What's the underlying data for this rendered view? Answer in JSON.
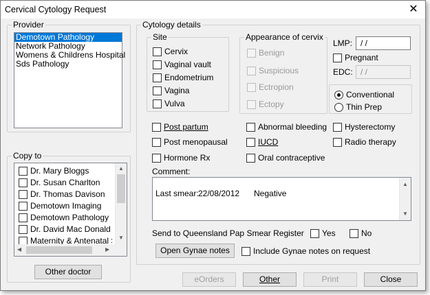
{
  "window": {
    "title": "Cervical Cytology Request",
    "close_glyph": "✕"
  },
  "provider": {
    "group_label": "Provider",
    "items": [
      "Demotown Pathology",
      "Network Pathology",
      "Womens & Childrens Hospital",
      "Sds Pathology"
    ],
    "selected_index": 0
  },
  "copy_to": {
    "group_label": "Copy to",
    "items": [
      "Dr. Mary Bloggs",
      "Dr. Susan Charlton",
      "Dr. Thomas Davison",
      "Demotown Imaging",
      "Demotown Pathology",
      "Dr. David Mac Donald",
      "Maternity & Antenatal Sc"
    ],
    "other_doctor_label": "Other doctor"
  },
  "cytology": {
    "group_label": "Cytology details",
    "site": {
      "label": "Site",
      "items": [
        "Cervix",
        "Vaginal vault",
        "Endometrium",
        "Vagina",
        "Vulva"
      ]
    },
    "appearance": {
      "label": "Appearance of cervix",
      "items": [
        "Benign",
        "Suspicious",
        "Ectropion",
        "Ectopy"
      ]
    },
    "lmp": {
      "label": "LMP:",
      "value": " / /"
    },
    "pregnant": "Pregnant",
    "edc": {
      "label": "EDC:",
      "value": " / /"
    },
    "prep": {
      "options": [
        "Conventional",
        "Thin Prep"
      ],
      "selected": "Conventional"
    },
    "status_checks": [
      "Post partum",
      "Post menopausal",
      "Hormone Rx",
      "Abnormal bleeding",
      "IUCD",
      "Oral contraceptive",
      "Hysterectomy",
      "Radio therapy"
    ],
    "comment": {
      "label": "Comment:",
      "smear_label": "Last smear:",
      "smear_date": "22/08/2012",
      "smear_result": "Negative"
    },
    "register": {
      "label": "Send to Queensland Pap Smear Register",
      "yes": "Yes",
      "no": "No"
    },
    "gynae": {
      "open_label": "Open Gynae notes",
      "include_label": "Include Gynae notes on request"
    }
  },
  "footer": {
    "eorders": "eOrders",
    "other": "Other",
    "print": "Print",
    "close": "Close"
  },
  "colors": {
    "selection": "#0078d7",
    "dialog_bg": "#f0f0f0"
  }
}
